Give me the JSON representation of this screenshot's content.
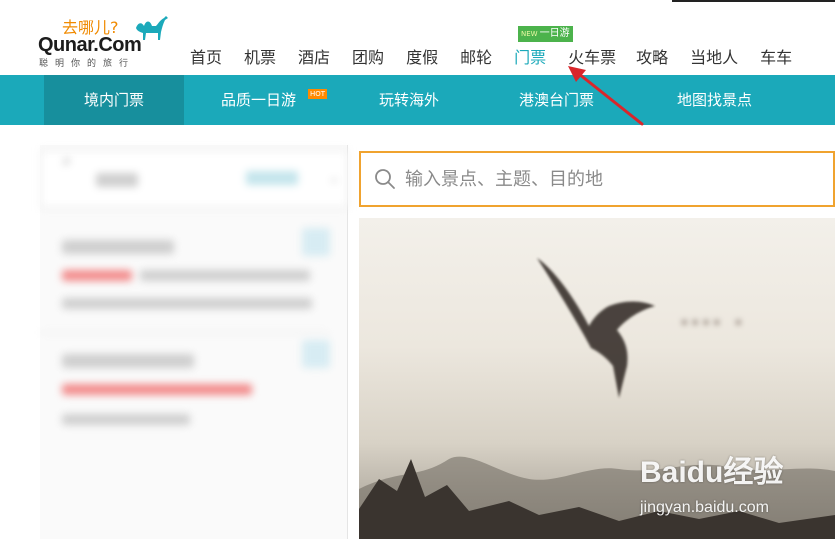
{
  "logo": {
    "slogan": "去哪儿?",
    "brand": "Qunar.Com",
    "tagline": "聪明你的旅行"
  },
  "topnav": {
    "items": [
      {
        "label": "首页"
      },
      {
        "label": "机票"
      },
      {
        "label": "酒店"
      },
      {
        "label": "团购"
      },
      {
        "label": "度假"
      },
      {
        "label": "邮轮"
      },
      {
        "label": "门票",
        "active": true
      },
      {
        "label": "火车票"
      },
      {
        "label": "攻略"
      },
      {
        "label": "当地人"
      },
      {
        "label": "车车"
      }
    ],
    "badge_new": "NEW",
    "badge_text": "一日游"
  },
  "subnav": {
    "items": [
      {
        "label": "境内门票",
        "active": true
      },
      {
        "label": "品质一日游",
        "badge": "HOT"
      },
      {
        "label": "玩转海外"
      },
      {
        "label": "港澳台门票"
      },
      {
        "label": "地图找景点"
      }
    ]
  },
  "search": {
    "placeholder": "输入景点、主题、目的地"
  },
  "colors": {
    "accent": "#1ba9ba",
    "search_border": "#f0a32f",
    "annotation_arrow": "#d9262b"
  },
  "watermark": {
    "title": "Baidu经验",
    "url": "jingyan.baidu.com"
  }
}
